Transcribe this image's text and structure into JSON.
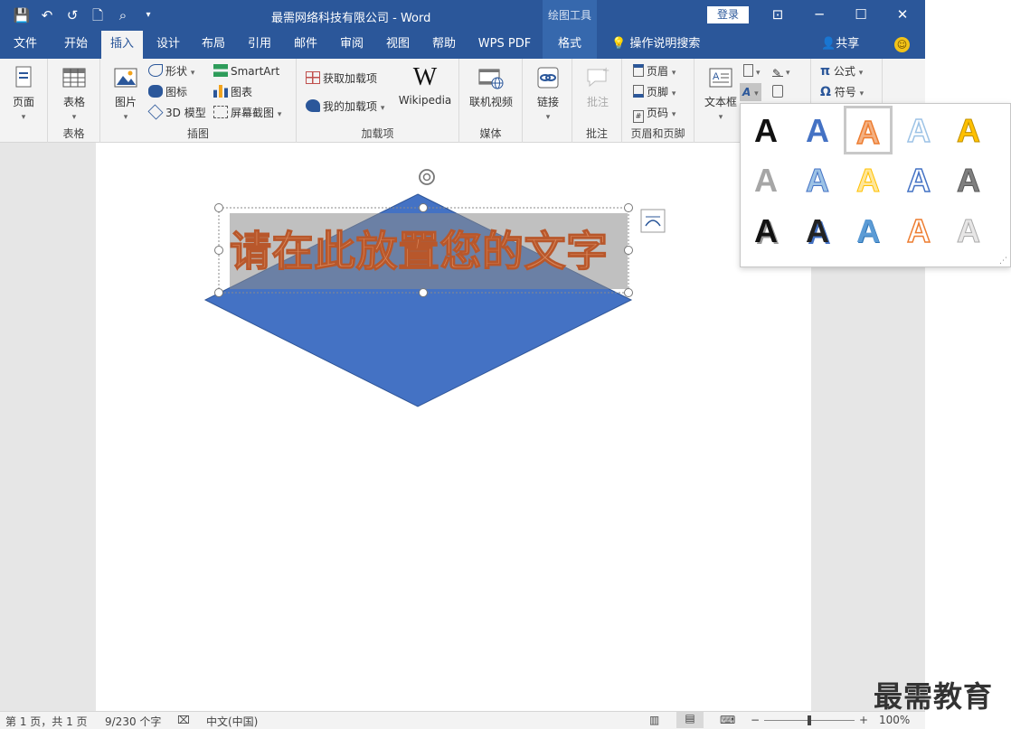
{
  "titlebar": {
    "title": "最需网络科技有限公司  -  Word",
    "context_tools": "绘图工具",
    "login": "登录",
    "qat": {
      "save": "💾",
      "undo": "↶",
      "redo": "↺",
      "new": "🗋",
      "touch": "⌕",
      "more": "▾"
    },
    "win": {
      "ribbon_opts": "⊡",
      "minimize": "─",
      "restore": "☐",
      "close": "✕"
    }
  },
  "tabs": [
    "文件",
    "开始",
    "插入",
    "设计",
    "布局",
    "引用",
    "邮件",
    "审阅",
    "视图",
    "帮助",
    "WPS PDF",
    "格式"
  ],
  "tell_me": "操作说明搜索",
  "share": "共享",
  "ribbon": {
    "pages": {
      "btn": "页面"
    },
    "table": {
      "btn": "表格",
      "group": "表格"
    },
    "illustrations": {
      "picture": "图片",
      "shapes": "形状",
      "icons": "图标",
      "model3d": "3D 模型",
      "smartart": "SmartArt",
      "chart": "图表",
      "screenshot": "屏幕截图",
      "group": "插图"
    },
    "addins": {
      "get": "获取加载项",
      "my": "我的加载项",
      "wiki": "Wikipedia",
      "group": "加载项"
    },
    "media": {
      "video": "联机视频",
      "group": "媒体"
    },
    "links": {
      "link": "链接"
    },
    "comments": {
      "comment": "批注",
      "group": "批注"
    },
    "headerfooter": {
      "header": "页眉",
      "footer": "页脚",
      "pagenum": "页码",
      "group": "页眉和页脚"
    },
    "text": {
      "textbox": "文本框"
    },
    "symbols": {
      "equation": "公式",
      "symbol": "符号"
    }
  },
  "document": {
    "wordart_text": "请在此放置您的文字"
  },
  "wordart_styles": [
    "A",
    "A",
    "A",
    "A",
    "A",
    "A",
    "A",
    "A",
    "A",
    "A",
    "A",
    "A",
    "A",
    "A",
    "A"
  ],
  "status": {
    "page": "第 1 页，共 1 页",
    "words": "9/230 个字",
    "lang": "中文(中国)",
    "zoom": "100%"
  },
  "watermark": "最需教育",
  "colors": {
    "brand": "#2b579a",
    "shape_fill": "#4472c4",
    "wordart_fill": "#d9885c",
    "wordart_outline": "#b8572b"
  }
}
